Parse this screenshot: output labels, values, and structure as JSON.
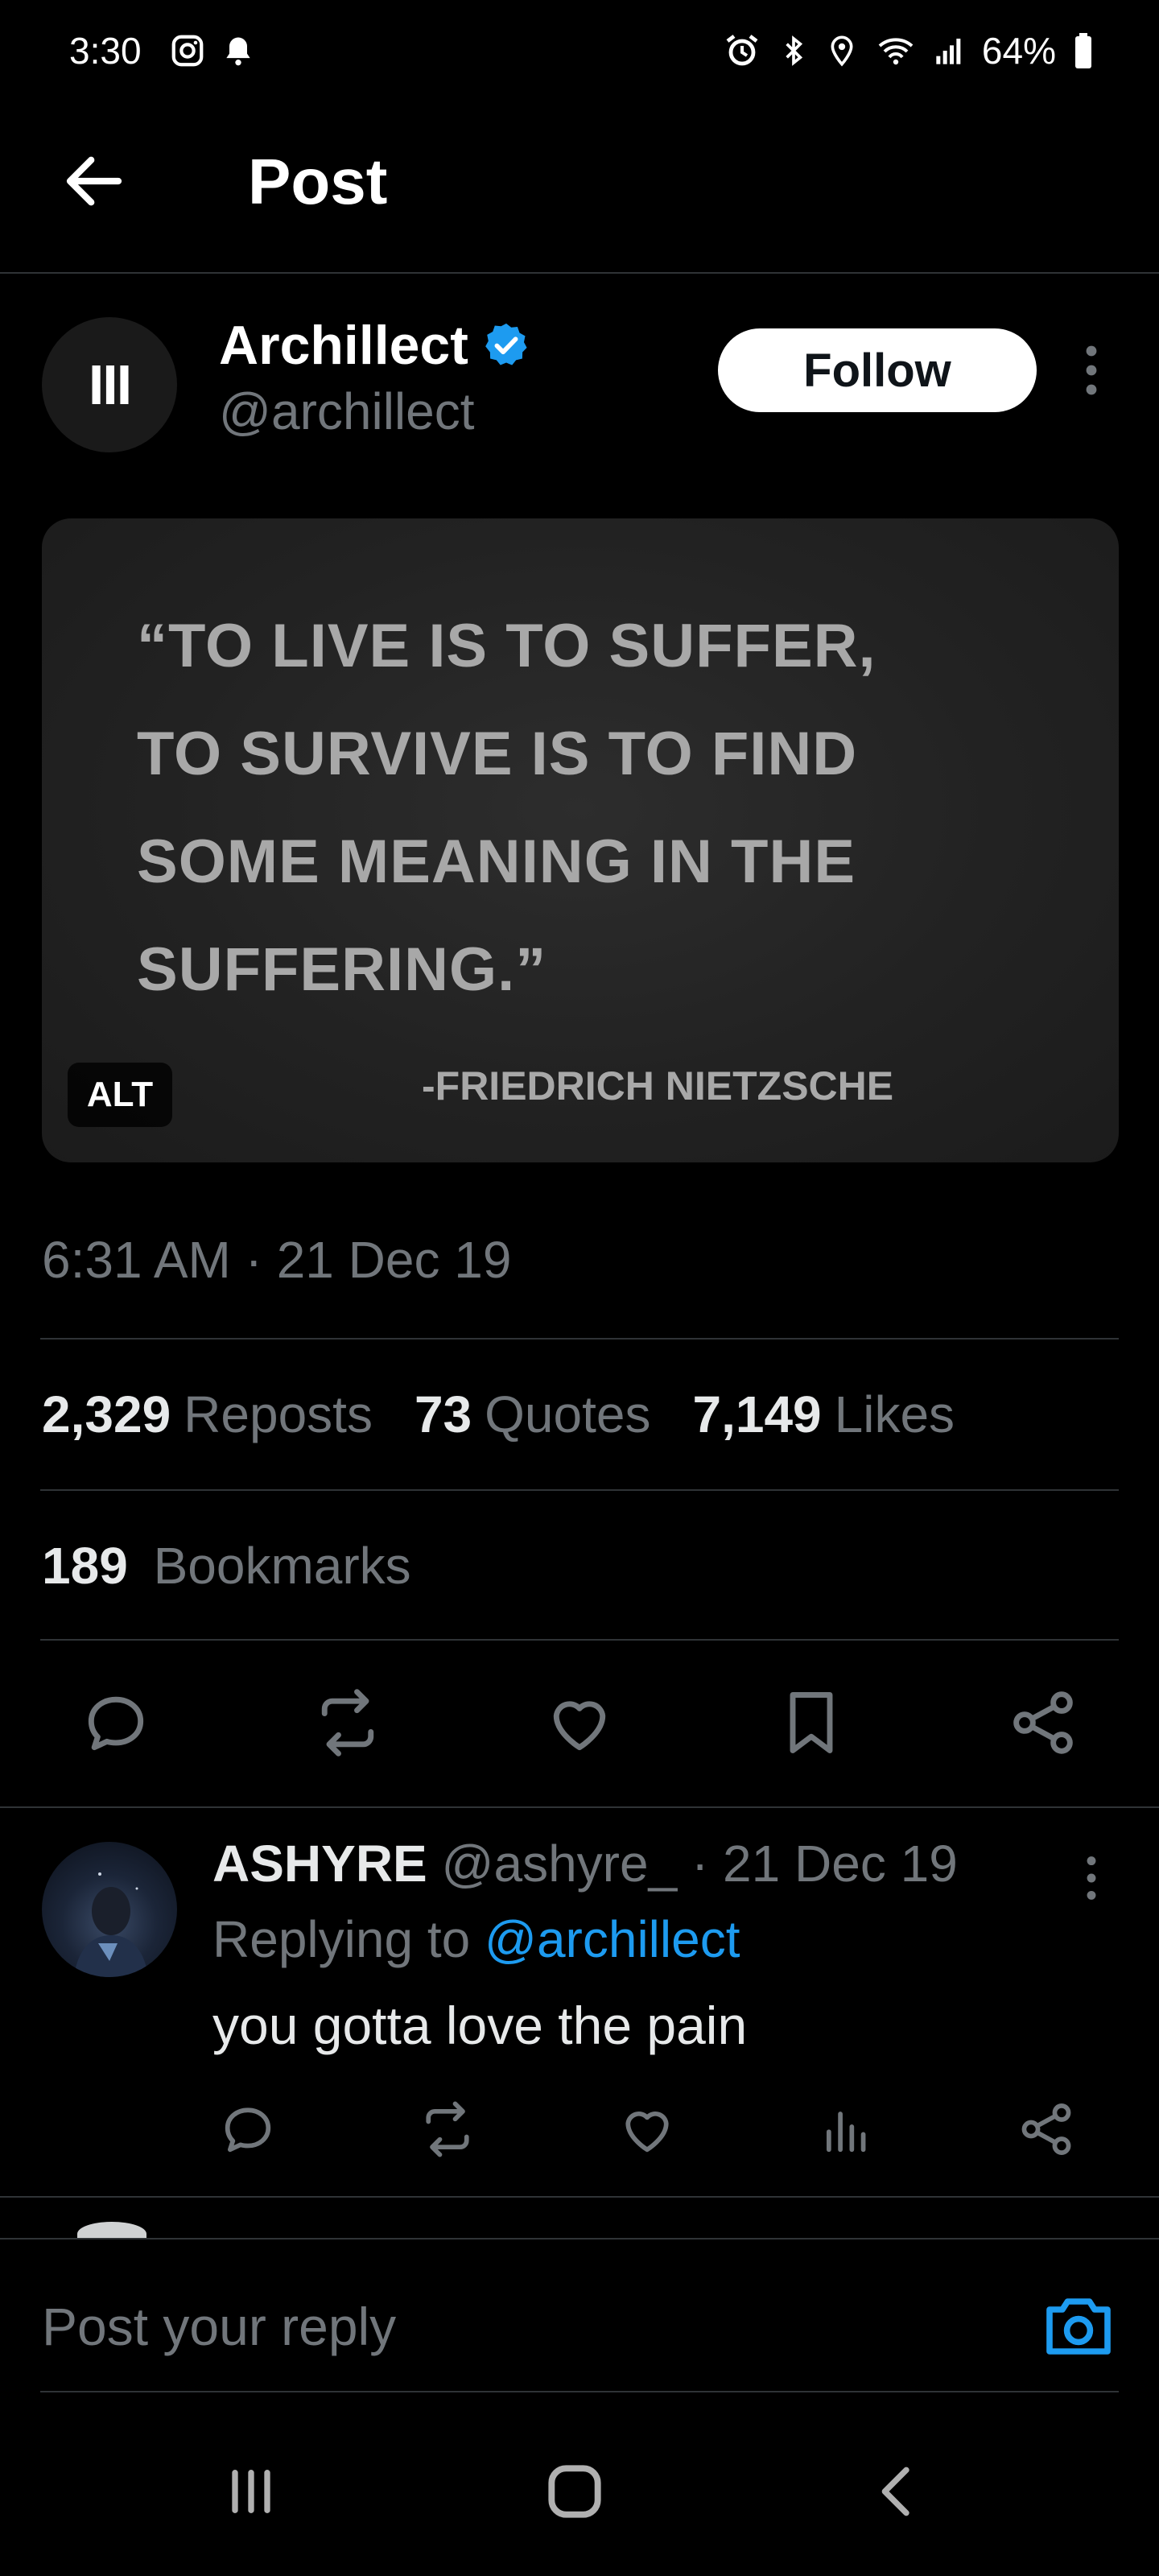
{
  "status_bar": {
    "time": "3:30",
    "battery": "64%"
  },
  "header": {
    "title": "Post"
  },
  "author": {
    "name": "Archillect",
    "handle": "@archillect",
    "avatar_text": "III",
    "follow_label": "Follow"
  },
  "media": {
    "quote_line1": "“TO LIVE IS TO SUFFER,",
    "quote_line2": "TO SURVIVE IS TO FIND",
    "quote_line3": "SOME MEANING IN THE",
    "quote_line4": "SUFFERING.”",
    "quote_author": "-FRIEDRICH NIETZSCHE",
    "alt_label": "ALT"
  },
  "timestamp": "6:31 AM · 21 Dec 19",
  "stats": {
    "reposts_count": "2,329",
    "reposts_label": "Reposts",
    "quotes_count": "73",
    "quotes_label": "Quotes",
    "likes_count": "7,149",
    "likes_label": "Likes",
    "bookmarks_count": "189",
    "bookmarks_label": "Bookmarks"
  },
  "reply": {
    "name": "ASHYRE",
    "handle": "@ashyre_",
    "date": "· 21 Dec 19",
    "replying_prefix": "Replying to",
    "replying_handle": "@archillect",
    "text": "you gotta love the pain"
  },
  "composer": {
    "placeholder": "Post your reply"
  },
  "colors": {
    "accent": "#1d9bf0",
    "background": "#000000",
    "muted": "#71767b"
  }
}
